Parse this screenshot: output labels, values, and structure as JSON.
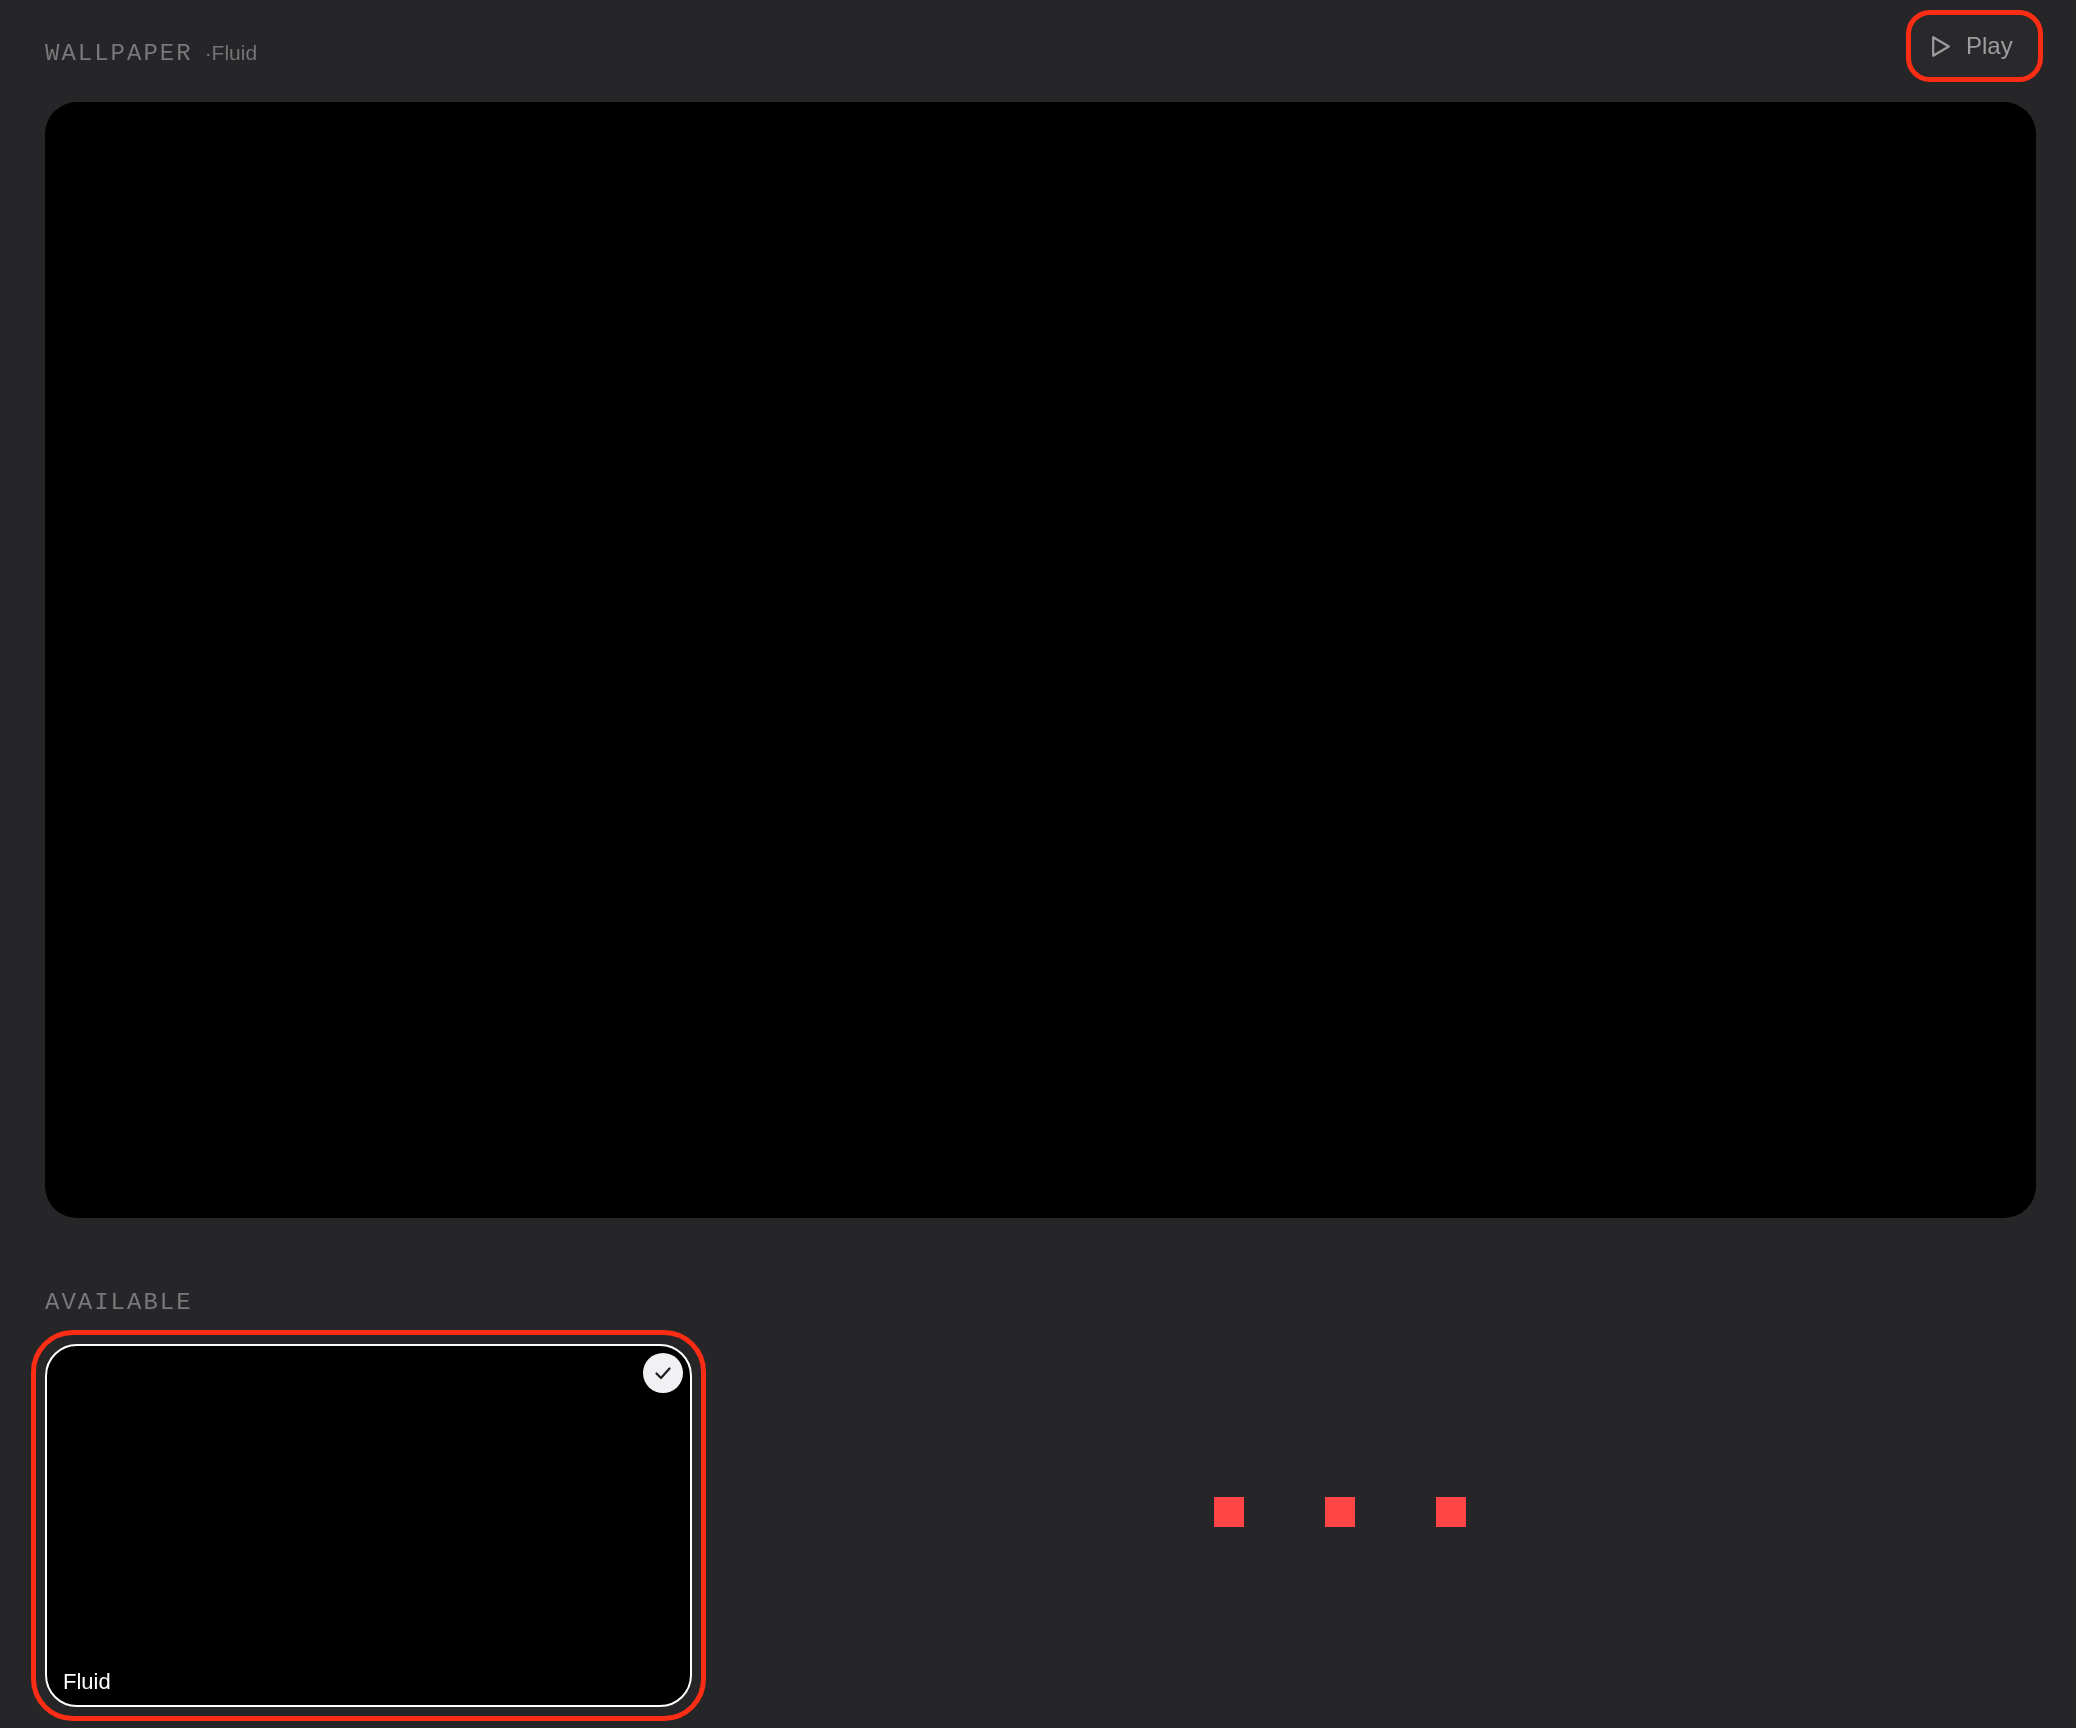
{
  "header": {
    "title": "WALLPAPER",
    "current": "·Fluid"
  },
  "play_button": {
    "label": "Play",
    "focused": true
  },
  "available": {
    "title": "AVAILABLE",
    "items": [
      {
        "name": "Fluid",
        "selected": true,
        "focused": true
      }
    ],
    "loading": true
  }
}
